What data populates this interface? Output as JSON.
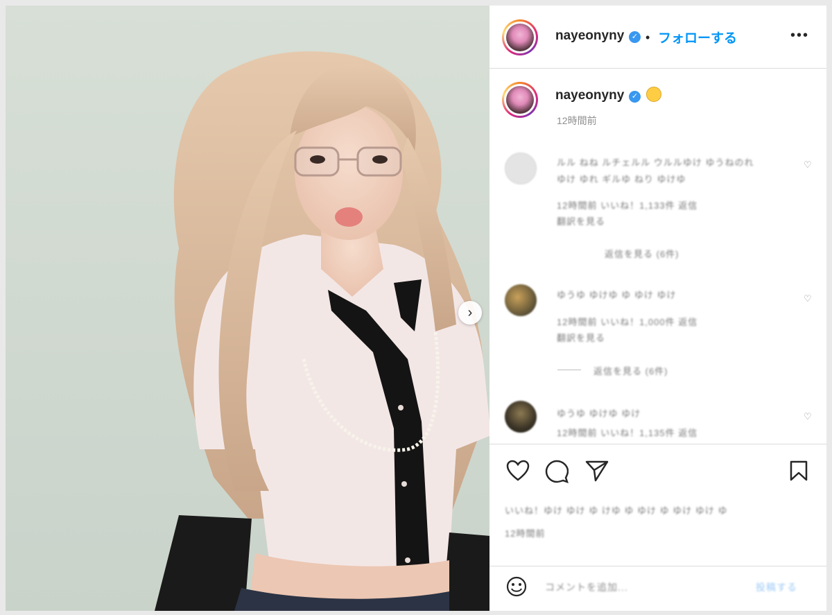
{
  "post": {
    "username": "nayeonyny",
    "follow_label": "フォローする",
    "separator": "•",
    "more_label": "•••",
    "time_ago": "12時間前"
  },
  "comments": [
    {
      "text_line1": "ルル ねね ルチェルル ウルルゆけ ゆうねのれ",
      "text_line2": "ゆけ ゆれ ギルゆ ねり ゆけゆ",
      "meta": "12時間前 いいね！1,133件 返信",
      "meta2": "翻訳を見る"
    },
    {
      "text_line1": "ゆうゆ ゆけゆ ゆ ゆけ ゆけ",
      "text_line2": "12時間前 いいね！1,000件 返信",
      "meta": "翻訳を見る"
    },
    {
      "text_line1": "ゆうゆ ゆけゆ ゆけ",
      "text_line2": "12時間前 いいね！1,135件 返信"
    }
  ],
  "replies": [
    {
      "label": "返信を見る (6件)"
    },
    {
      "label": "返信を見る (6件)"
    }
  ],
  "likes_line": "いいね！ゆけ ゆけ ゆ けゆ ゆ ゆけ ゆ ゆけ ゆけ ゆ",
  "likes_sub": "12時間前",
  "comment_placeholder": "コメントを追加...",
  "post_label": "投稿する",
  "colors": {
    "accent": "#0095f6",
    "verified": "#3897f0",
    "text": "#262626",
    "muted": "#8e8e8e"
  },
  "icons": [
    "more-icon",
    "heart-icon",
    "comment-icon",
    "share-icon",
    "bookmark-icon",
    "emoji-icon",
    "chevron-right-icon",
    "verified-icon"
  ]
}
